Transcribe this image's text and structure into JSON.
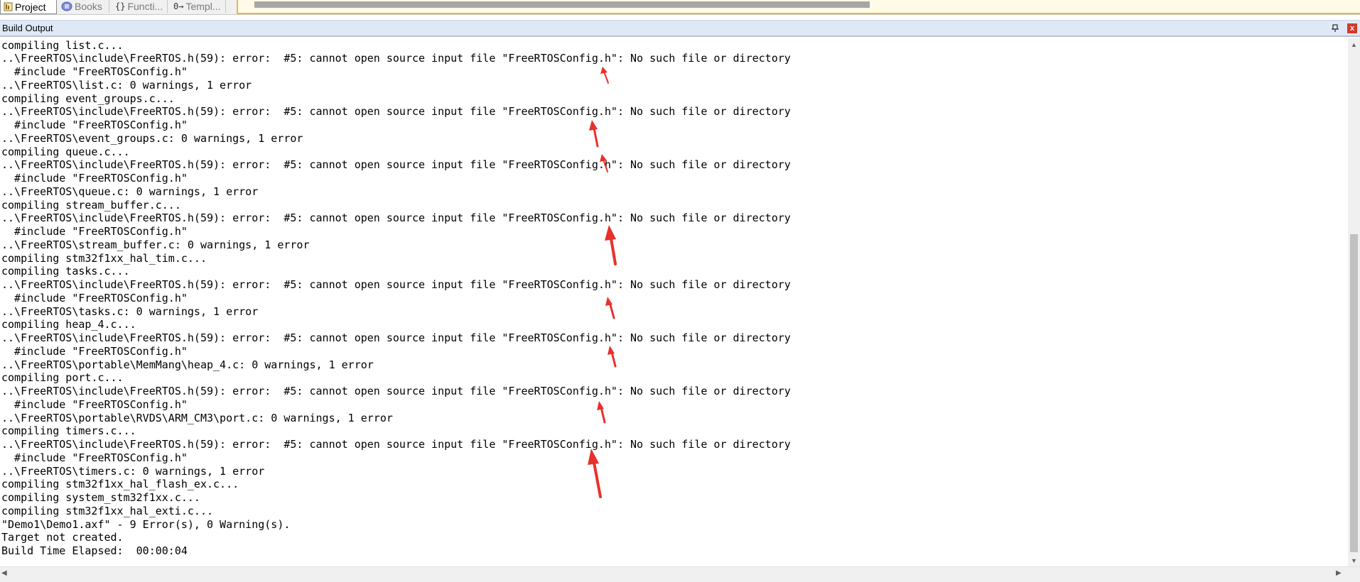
{
  "tabs": [
    {
      "label": "Project",
      "icon": "project-icon"
    },
    {
      "label": "Books",
      "icon": "books-icon"
    },
    {
      "label": "Functi...",
      "icon": "functions-icon"
    },
    {
      "label": "Templ...",
      "icon": "templates-icon"
    }
  ],
  "panel": {
    "title": "Build Output",
    "pin": "❖",
    "close": "x"
  },
  "output_lines": [
    "compiling list.c...",
    "..\\FreeRTOS\\include\\FreeRTOS.h(59): error:  #5: cannot open source input file \"FreeRTOSConfig.h\": No such file or directory",
    "  #include \"FreeRTOSConfig.h\"",
    "..\\FreeRTOS\\list.c: 0 warnings, 1 error",
    "compiling event_groups.c...",
    "..\\FreeRTOS\\include\\FreeRTOS.h(59): error:  #5: cannot open source input file \"FreeRTOSConfig.h\": No such file or directory",
    "  #include \"FreeRTOSConfig.h\"",
    "..\\FreeRTOS\\event_groups.c: 0 warnings, 1 error",
    "compiling queue.c...",
    "..\\FreeRTOS\\include\\FreeRTOS.h(59): error:  #5: cannot open source input file \"FreeRTOSConfig.h\": No such file or directory",
    "  #include \"FreeRTOSConfig.h\"",
    "..\\FreeRTOS\\queue.c: 0 warnings, 1 error",
    "compiling stream_buffer.c...",
    "..\\FreeRTOS\\include\\FreeRTOS.h(59): error:  #5: cannot open source input file \"FreeRTOSConfig.h\": No such file or directory",
    "  #include \"FreeRTOSConfig.h\"",
    "..\\FreeRTOS\\stream_buffer.c: 0 warnings, 1 error",
    "compiling stm32f1xx_hal_tim.c...",
    "compiling tasks.c...",
    "..\\FreeRTOS\\include\\FreeRTOS.h(59): error:  #5: cannot open source input file \"FreeRTOSConfig.h\": No such file or directory",
    "  #include \"FreeRTOSConfig.h\"",
    "..\\FreeRTOS\\tasks.c: 0 warnings, 1 error",
    "compiling heap_4.c...",
    "..\\FreeRTOS\\include\\FreeRTOS.h(59): error:  #5: cannot open source input file \"FreeRTOSConfig.h\": No such file or directory",
    "  #include \"FreeRTOSConfig.h\"",
    "..\\FreeRTOS\\portable\\MemMang\\heap_4.c: 0 warnings, 1 error",
    "compiling port.c...",
    "..\\FreeRTOS\\include\\FreeRTOS.h(59): error:  #5: cannot open source input file \"FreeRTOSConfig.h\": No such file or directory",
    "  #include \"FreeRTOSConfig.h\"",
    "..\\FreeRTOS\\portable\\RVDS\\ARM_CM3\\port.c: 0 warnings, 1 error",
    "compiling timers.c...",
    "..\\FreeRTOS\\include\\FreeRTOS.h(59): error:  #5: cannot open source input file \"FreeRTOSConfig.h\": No such file or directory",
    "  #include \"FreeRTOSConfig.h\"",
    "..\\FreeRTOS\\timers.c: 0 warnings, 1 error",
    "compiling stm32f1xx_hal_flash_ex.c...",
    "compiling system_stm32f1xx.c...",
    "compiling stm32f1xx_hal_exti.c...",
    "\"Demo1\\Demo1.axf\" - 9 Error(s), 0 Warning(s).",
    "Target not created.",
    "Build Time Elapsed:  00:00:04"
  ],
  "colors": {
    "annotation_arrow": "#e8312a",
    "panel_header": "#dfe9f5",
    "close_button": "#d9372b"
  }
}
